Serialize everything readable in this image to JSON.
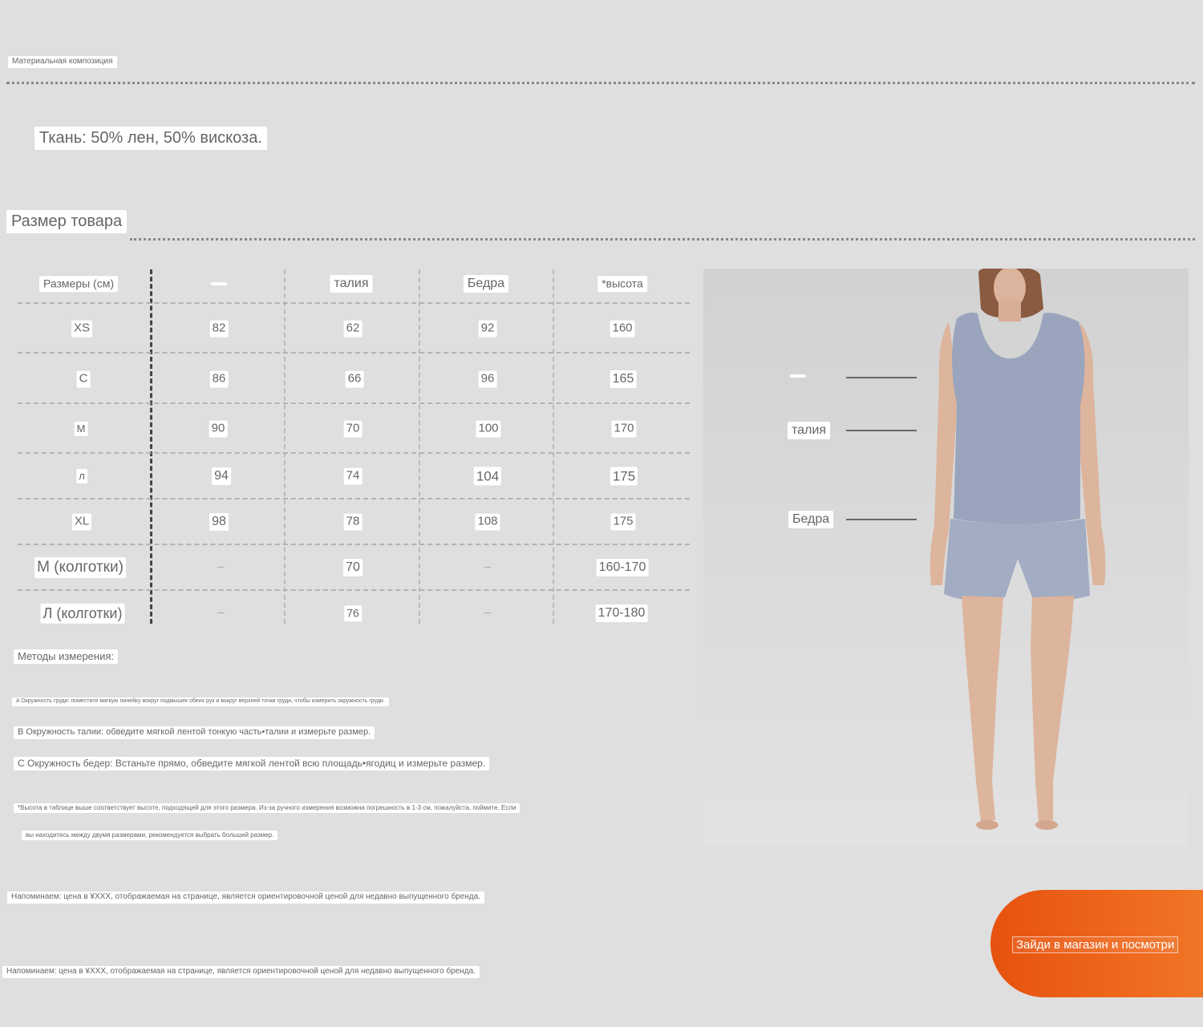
{
  "material": {
    "heading": "Материальная композиция",
    "fabric": "Ткань: 50% лен, 50% вискоза."
  },
  "size": {
    "heading": "Размер товара",
    "columns": [
      "Размеры (см)",
      "",
      "талия",
      "Бедра",
      "*высота"
    ],
    "rows": [
      [
        "XS",
        "82",
        "62",
        "92",
        "160"
      ],
      [
        "С",
        "86",
        "66",
        "96",
        "165"
      ],
      [
        "M",
        "90",
        "70",
        "100",
        "170"
      ],
      [
        "л",
        "94",
        "74",
        "104",
        "175"
      ],
      [
        "XL",
        "98",
        "78",
        "108",
        "175"
      ],
      [
        "М (колготки)",
        "–",
        "70",
        "–",
        "160-170"
      ],
      [
        "Л (колготки)",
        "–",
        "76",
        "–",
        "170-180"
      ]
    ]
  },
  "model_labels": {
    "bust": "",
    "waist": "талия",
    "hips": "Бедра"
  },
  "methods": {
    "heading": "Методы измерения:",
    "a": "A Окружность груди: поместите мягкую линейку вокруг подмышек обеих рук и вокруг верхней точки груди, чтобы измерить окружность груди.",
    "b": "B Окружность талии: обведите мягкой лентой тонкую часть•талии и измерьте размер.",
    "c": "C Окружность бедер: Встаньте прямо, обведите мягкой лентой всю площадь•ягодиц и измерьте размер.",
    "note1": "*Высота в таблице выше соответствует высоте, подходящей для этого размера. Из-за ручного измерения возможна погрешность в 1-3 см, пожалуйста, поймите. Если",
    "note2": "вы находитесь между двумя размерами, рекомендуется выбрать больший размер."
  },
  "reminders": [
    "Напоминаем: цена в ¥XXX, отображаемая на странице, является ориентировочной ценой для недавно выпущенного бренда.",
    "Напоминаем: цена в ¥XXX, отображаемая на странице, является ориентировочной ценой для недавно выпущенного бренда."
  ],
  "cta": {
    "label": "Зайди в магазин и посмотри"
  },
  "colors": {
    "accent": "#e6520f",
    "background": "#dfdfdf",
    "garment": "#9aa5bd"
  }
}
